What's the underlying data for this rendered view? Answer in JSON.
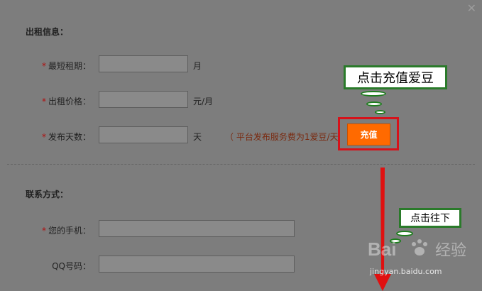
{
  "close_icon": "close-icon",
  "rental_section": {
    "title": "出租信息：",
    "fields": [
      {
        "label": "最短租期：",
        "required": true,
        "unit": "月",
        "value": ""
      },
      {
        "label": "出租价格：",
        "required": true,
        "unit": "元/月",
        "value": ""
      },
      {
        "label": "发布天数：",
        "required": true,
        "unit": "天",
        "value": ""
      }
    ],
    "note": "（ 平台发布服务费为1爱豆/天",
    "recharge_label": "充值"
  },
  "contact_section": {
    "title": "联系方式：",
    "fields": [
      {
        "label": "您的手机：",
        "required": true,
        "value": ""
      },
      {
        "label": "QQ号码：",
        "required": false,
        "value": ""
      }
    ]
  },
  "annotations": {
    "recharge_hint": "点击充值爱豆",
    "scroll_hint": "点击往下",
    "accent_color": "#d6121a",
    "callout_border_color": "#2a7a2a"
  },
  "watermark": {
    "brand": "Bai",
    "brand_suffix": "经验",
    "url": "jingyan.baidu.com"
  }
}
